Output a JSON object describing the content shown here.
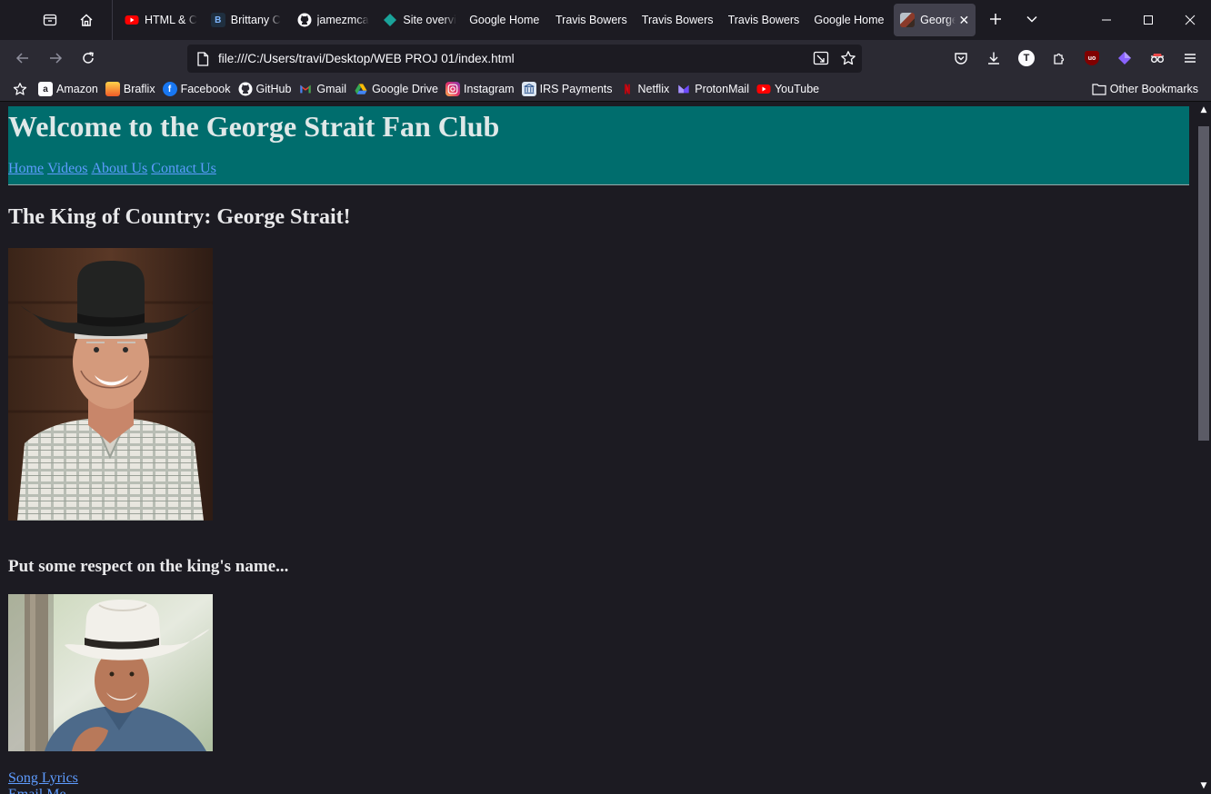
{
  "browser": {
    "tabs": [
      {
        "title": "HTML & C",
        "favicon": "youtube-icon",
        "color": "#ff0000"
      },
      {
        "title": "Brittany C",
        "favicon": "b-icon",
        "color": "#1f2f3f"
      },
      {
        "title": "jamezmca",
        "favicon": "github-icon",
        "color": "#ffffff"
      },
      {
        "title": "Site overvi",
        "favicon": "diamond-icon",
        "color": "#1aa39a"
      },
      {
        "title": "Google Home",
        "favicon": "",
        "color": ""
      },
      {
        "title": "Travis Bowers",
        "favicon": "",
        "color": ""
      },
      {
        "title": "Travis Bowers",
        "favicon": "",
        "color": ""
      },
      {
        "title": "Travis Bowers",
        "favicon": "",
        "color": ""
      },
      {
        "title": "Google Home",
        "favicon": "",
        "color": ""
      },
      {
        "title": "George",
        "favicon": "photo-icon",
        "color": "#8a3a2a",
        "active": true
      }
    ],
    "url": "file:///C:/Users/travi/Desktop/WEB PROJ 01/index.html",
    "bookmarks": [
      {
        "label": "Amazon",
        "icon": "amazon-icon"
      },
      {
        "label": "Braflix",
        "icon": "braflix-icon"
      },
      {
        "label": "Facebook",
        "icon": "facebook-icon"
      },
      {
        "label": "GitHub",
        "icon": "github-icon"
      },
      {
        "label": "Gmail",
        "icon": "gmail-icon"
      },
      {
        "label": "Google Drive",
        "icon": "google-drive-icon"
      },
      {
        "label": "Instagram",
        "icon": "instagram-icon"
      },
      {
        "label": "IRS Payments",
        "icon": "irs-icon"
      },
      {
        "label": "Netflix",
        "icon": "netflix-icon"
      },
      {
        "label": "ProtonMail",
        "icon": "protonmail-icon"
      },
      {
        "label": "YouTube",
        "icon": "youtube-icon"
      }
    ],
    "other_bookmarks": "Other Bookmarks",
    "profile_initial": "T",
    "ublock_label": "uo"
  },
  "page": {
    "header_title": "Welcome to the George Strait Fan Club",
    "nav": [
      "Home",
      "Videos",
      "About Us",
      "Contact Us"
    ],
    "heading": "The King of Country: George Strait!",
    "subheading": "Put some respect on the king's name...",
    "links": [
      "Song Lyrics",
      "Email Me"
    ]
  }
}
